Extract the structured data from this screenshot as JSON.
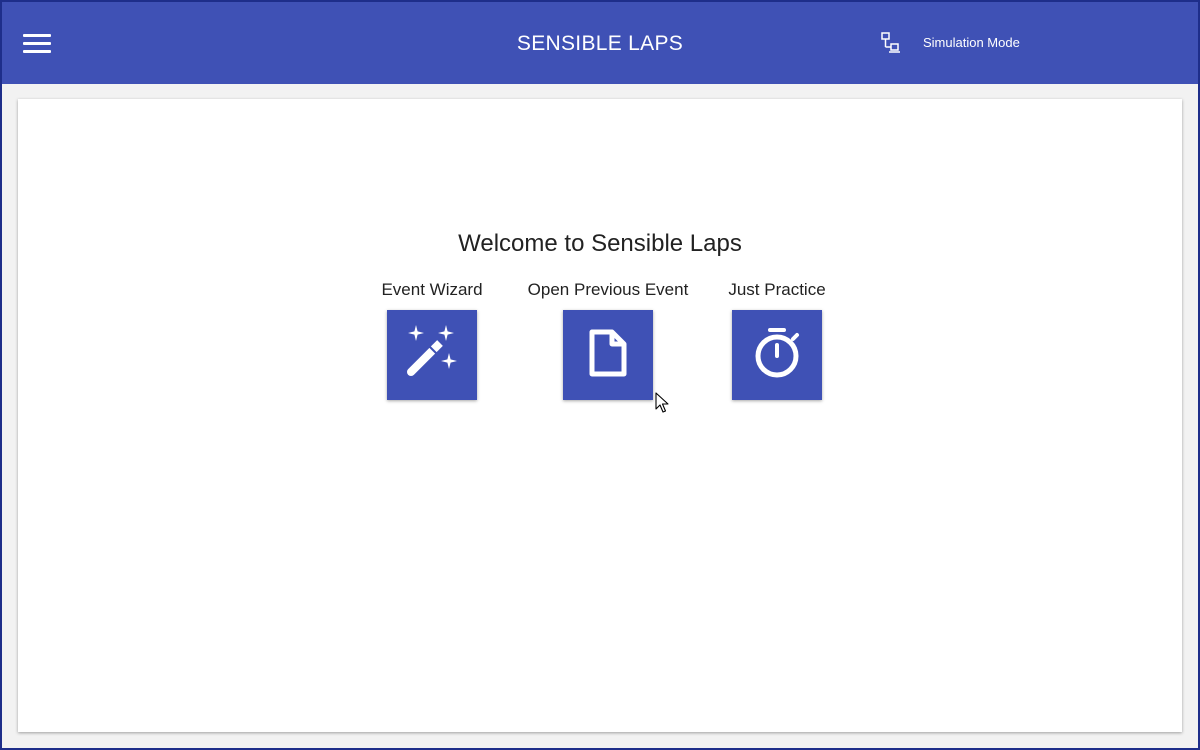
{
  "app": {
    "title": "SENSIBLE LAPS",
    "simulation_mode_label": "Simulation Mode",
    "menu_icon": "hamburger-menu-icon",
    "simulation_icon": "network-icon"
  },
  "main": {
    "welcome_text": "Welcome to Sensible Laps",
    "actions": [
      {
        "label": "Event Wizard",
        "icon": "magic-wand-icon"
      },
      {
        "label": "Open Previous Event",
        "icon": "document-icon"
      },
      {
        "label": "Just Practice",
        "icon": "stopwatch-icon"
      }
    ]
  },
  "colors": {
    "primary": "#3f51b5",
    "window_border": "#1e2e8a",
    "text": "#222222",
    "background": "#ffffff"
  }
}
